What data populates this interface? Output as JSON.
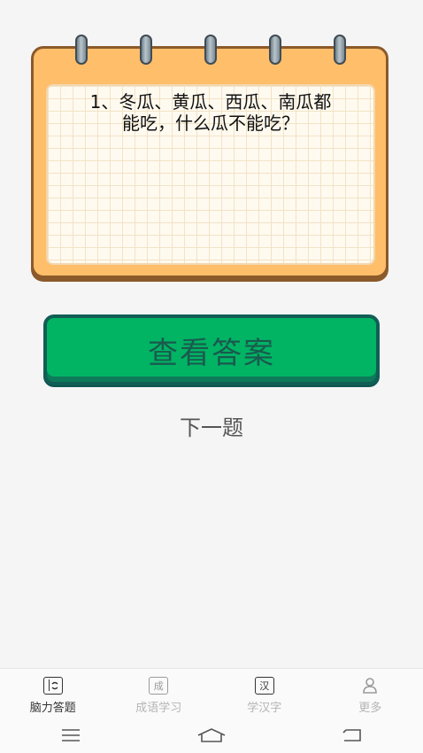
{
  "question": {
    "line1": "1、冬瓜、黄瓜、西瓜、南瓜都",
    "line2": "能吃，什么瓜不能吃？"
  },
  "buttons": {
    "answer_label": "查看答案",
    "next_label": "下一题"
  },
  "tabs": [
    {
      "label": "脑力答题",
      "icon": "brain-quiz-icon",
      "active": true
    },
    {
      "label": "成语学习",
      "icon_text": "成",
      "active": false
    },
    {
      "label": "学汉字",
      "icon_text": "汉",
      "active": false
    },
    {
      "label": "更多",
      "icon": "user-icon",
      "active": false
    }
  ],
  "colors": {
    "card_bg": "#ffbe6a",
    "card_border": "#8b5a2b",
    "button_green": "#00b464",
    "button_border": "#115e55",
    "active_tab": "#333333",
    "inactive_tab": "#b5b5b5"
  }
}
